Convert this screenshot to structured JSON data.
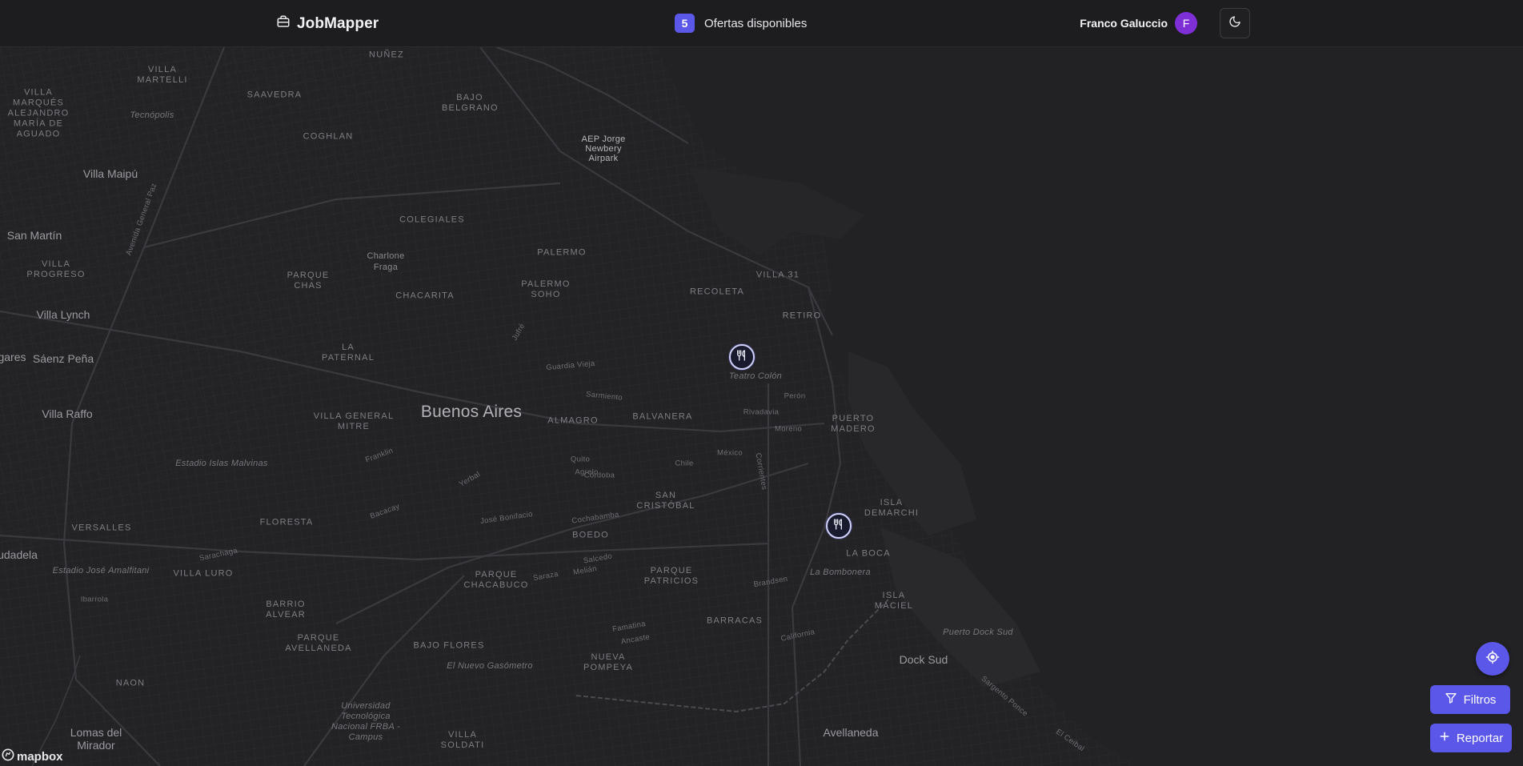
{
  "header": {
    "brand": "JobMapper",
    "offers_count": "5",
    "offers_label": "Ofertas disponibles",
    "user_name": "Franco Galuccio",
    "user_initial": "F"
  },
  "map": {
    "attribution": "mapbox",
    "labels": {
      "nunez": "NUÑEZ",
      "villa_martelli": "VILLA MARTELLI",
      "saavedra": "SAAVEDRA",
      "bajo_belgrano": "BAJO BELGRANO",
      "villa_marques": "VILLA MARQUÉS ALEJANDRO MARÍA DE AGUADO",
      "tecnopolis": "Tecnópolis",
      "coghlan": "COGHLAN",
      "aep": "AEP Jorge Newbery Airpark",
      "villa_maipu": "Villa Maipú",
      "colegiales": "COLEGIALES",
      "san_martin": "San Martín",
      "villa_progreso": "VILLA PROGRESO",
      "charlone_fraga": "Charlone Fraga",
      "palermo": "PALERMO",
      "parque_chas": "PARQUE CHAS",
      "chacarita": "CHACARITA",
      "palermo_soho": "PALERMO SOHO",
      "recoleta": "RECOLETA",
      "villa_31": "VILLA 31",
      "villa_lynch": "Villa Lynch",
      "retiro": "RETIRO",
      "la_paternal": "LA PATERNAL",
      "saenz_pena": "Sáenz Peña",
      "gares": "gares",
      "teatro_colon": "Teatro Colón",
      "villa_raffo": "Villa Raffo",
      "buenos_aires": "Buenos Aires",
      "villa_general_mitre": "VILLA GENERAL MITRE",
      "almagro": "ALMAGRO",
      "balvanera": "BALVANERA",
      "puerto_madero": "PUERTO MADERO",
      "estadio_malvinas": "Estadio Islas Malvinas",
      "isla_demarchi": "ISLA DEMARCHI",
      "san_cristobal": "SAN CRISTÓBAL",
      "versalles": "VERSALLES",
      "floresta": "FLORESTA",
      "boedo": "BOEDO",
      "la_boca": "LA BOCA",
      "udadela": "udadela",
      "estadio_amalfitani": "Estadio José Amalfitani",
      "villa_luro": "VILLA LURO",
      "parque_chacabuco": "PARQUE CHACABUCO",
      "parque_patricios": "PARQUE PATRICIOS",
      "la_bombonera": "La Bombonera",
      "isla_maciel": "ISLA MACIEL",
      "barrio_alvear": "BARRIO ALVEAR",
      "barracas": "BARRACAS",
      "parque_avellaneda": "PARQUE AVELLANEDA",
      "puerto_dock_sud": "Puerto Dock Sud",
      "bajo_flores": "BAJO FLORES",
      "nueva_pompeya": "NUEVA POMPEYA",
      "dock_sud": "Dock Sud",
      "el_nuevo_gasometro": "El Nuevo Gasómetro",
      "naon": "NAON",
      "universidad": "Universidad Tecnológica Nacional FRBA - Campus",
      "avellaneda": "Avellaneda",
      "lomas_del_mirador": "Lomas del Mirador",
      "villa_soldati": "VILLA SOLDATI",
      "sargento_ponce": "Sargento Ponce",
      "el_ceibal": "El Ceibal",
      "st_jufre": "Jufré",
      "st_rivadavia": "Rivadavia",
      "st_corrientes": "Corrientes",
      "st_cordoba": "Córdoba",
      "st_cochabamba": "Cochabamba",
      "st_bonifacio": "José Bonifacio",
      "st_california": "California",
      "st_brandsen": "Brandsen",
      "st_mexico": "México",
      "st_chile": "Chile",
      "st_peron": "Perón",
      "st_moreno": "Moreno",
      "st_sarmiento": "Sarmiento",
      "st_guardia_vieja": "Guardia Vieja",
      "st_quito": "Quito",
      "st_agrelo": "Agrelo",
      "st_saraza": "Saraza",
      "st_salcedo": "Salcedo",
      "st_melan": "Melián",
      "st_famatina": "Famatina",
      "st_ancaste": "Ancaste",
      "st_av_general_paz": "Avenida General Paz",
      "st_yerbal": "Yerbal",
      "st_bacacay": "Bacacay",
      "st_franklin": "Franklin",
      "st_sarachaga": "Sarachaga",
      "st_ibarrola": "Ibarrola"
    }
  },
  "controls": {
    "filters_label": "Filtros",
    "report_label": "Reportar"
  },
  "colors": {
    "accent": "#5b57e8",
    "avatar": "#7e2fd6",
    "background": "#1c1c1e"
  }
}
